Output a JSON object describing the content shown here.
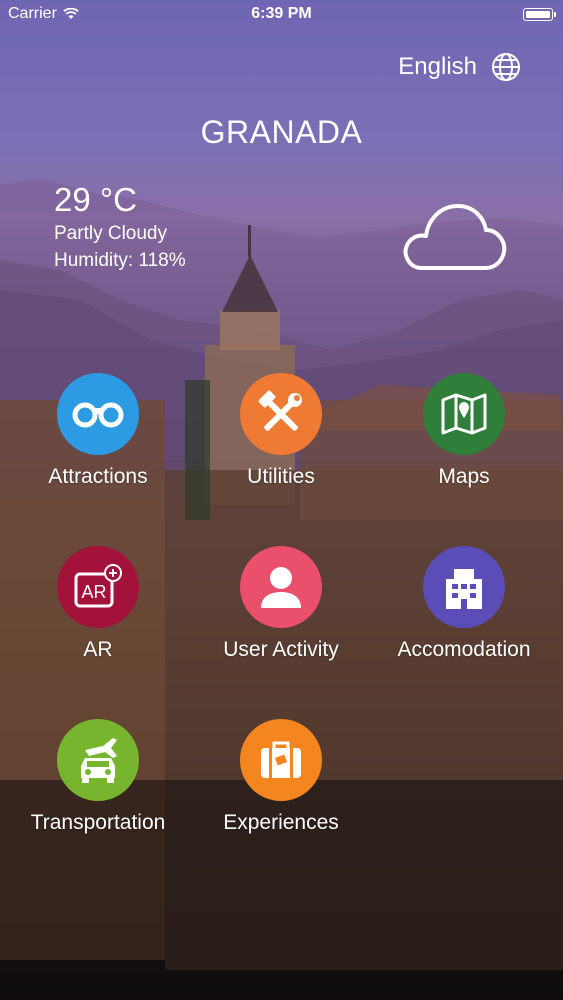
{
  "status": {
    "carrier": "Carrier",
    "time": "6:39 PM"
  },
  "language": {
    "label": "English",
    "icon": "globe-icon"
  },
  "city": "GRANADA",
  "weather": {
    "temperature": "29 °C",
    "condition": "Partly Cloudy",
    "humidity": "Humidity: 118%",
    "icon": "cloud-icon"
  },
  "menu": [
    {
      "label": "Attractions",
      "icon": "binoculars-icon",
      "color": "#2d9be4"
    },
    {
      "label": "Utilities",
      "icon": "tools-icon",
      "color": "#ef7a33"
    },
    {
      "label": "Maps",
      "icon": "map-icon",
      "color": "#2f7f3a"
    },
    {
      "label": "AR",
      "icon": "ar-icon",
      "color": "#a3123a"
    },
    {
      "label": "User Activity",
      "icon": "user-icon",
      "color": "#ea4f6c"
    },
    {
      "label": "Accomodation",
      "icon": "building-icon",
      "color": "#5b4db7"
    },
    {
      "label": "Transportation",
      "icon": "transport-icon",
      "color": "#78b52f"
    },
    {
      "label": "Experiences",
      "icon": "suitcase-icon",
      "color": "#f5861f"
    }
  ]
}
